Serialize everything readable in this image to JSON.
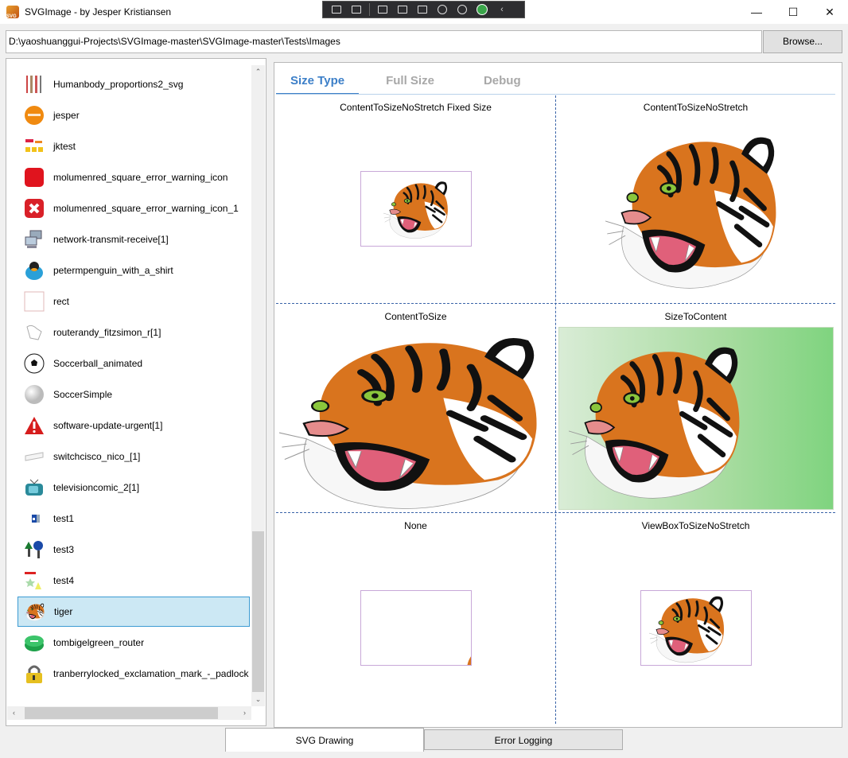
{
  "window": {
    "title": "SVGImage - by Jesper Kristiansen",
    "minimize": "—",
    "maximize": "☐",
    "close": "✕"
  },
  "path": {
    "value": "D:\\yaoshuanggui-Projects\\SVGImage-master\\SVGImage-master\\Tests\\Images",
    "browse_label": "Browse..."
  },
  "file_list": {
    "items": [
      {
        "label": "Humanbody_proportions2_svg",
        "icon": "human-body-icon"
      },
      {
        "label": "jesper",
        "icon": "orange-circle-icon"
      },
      {
        "label": "jktest",
        "icon": "yellow-grid-icon"
      },
      {
        "label": "molumenred_square_error_warning_icon",
        "icon": "red-square-icon"
      },
      {
        "label": "molumenred_square_error_warning_icon_1",
        "icon": "red-error-x-icon"
      },
      {
        "label": "network-transmit-receive[1]",
        "icon": "network-computers-icon"
      },
      {
        "label": "petermpenguin_with_a_shirt",
        "icon": "penguin-icon"
      },
      {
        "label": "rect",
        "icon": "empty-rect-icon"
      },
      {
        "label": "routerandy_fitzsimon_r[1]",
        "icon": "router-sketch-icon"
      },
      {
        "label": "Soccerball_animated",
        "icon": "soccerball-icon"
      },
      {
        "label": "SoccerSimple",
        "icon": "white-ball-icon"
      },
      {
        "label": "software-update-urgent[1]",
        "icon": "warning-triangle-icon"
      },
      {
        "label": "switchcisco_nico_[1]",
        "icon": "switch-icon"
      },
      {
        "label": "televisioncomic_2[1]",
        "icon": "television-icon"
      },
      {
        "label": "test1",
        "icon": "blue-square-icon"
      },
      {
        "label": "test3",
        "icon": "trees-icon"
      },
      {
        "label": "test4",
        "icon": "shapes-icon"
      },
      {
        "label": "tiger",
        "icon": "tiger-icon"
      },
      {
        "label": "tombigelgreen_router",
        "icon": "green-router-icon"
      },
      {
        "label": "tranberrylocked_exclamation_mark_-_padlock",
        "icon": "padlock-icon"
      }
    ],
    "selected": "tiger"
  },
  "scroll_arrows": {
    "up": "⌃",
    "down": "⌄",
    "left": "‹",
    "right": "›"
  },
  "tabs": [
    {
      "label": "Size Type",
      "active": true
    },
    {
      "label": "Full Size",
      "active": false
    },
    {
      "label": "Debug",
      "active": false
    }
  ],
  "cells": {
    "c1": "ContentToSizeNoStretch Fixed Size",
    "c2": "ContentToSizeNoStretch",
    "c3": "ContentToSize",
    "c4": "SizeToContent",
    "c5": "None",
    "c6": "ViewBoxToSizeNoStretch"
  },
  "bottom_tabs": [
    {
      "label": "SVG Drawing",
      "active": true
    },
    {
      "label": "Error Logging",
      "active": false
    }
  ],
  "colors": {
    "accent": "#3c7fc8",
    "selection": "#cce8f4",
    "tiger_orange": "#d9741e"
  }
}
